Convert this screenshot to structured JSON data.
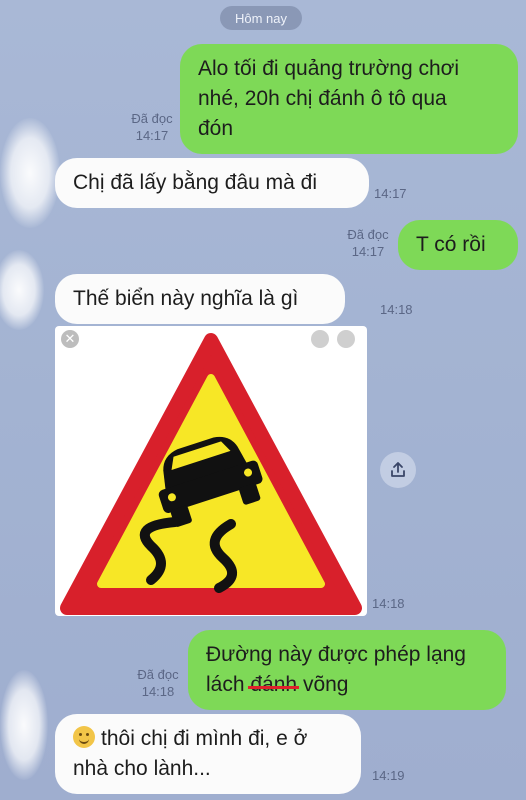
{
  "day_divider": "Hôm nay",
  "messages": [
    {
      "text_line1": "Alo tối đi quảng trường chơi",
      "text_line2": "nhé, 20h chị đánh ô tô qua",
      "text_line3": "đón",
      "status": "Đã đọc",
      "time": "14:17"
    },
    {
      "text": "Chị đã lấy bằng đâu mà đi",
      "time": "14:17"
    },
    {
      "text": "T có rồi",
      "status": "Đã đọc",
      "time": "14:17"
    },
    {
      "text": "Thế biển này nghĩa là gì",
      "time": "14:18"
    },
    {
      "image_alt": "slippery-road-warning-sign",
      "time": "14:18"
    },
    {
      "text_line1": "Đường này được phép lạng",
      "text_line2_a": "lách",
      "text_line2_strike": "đánh",
      "text_line2_b": "võng",
      "status": "Đã đọc",
      "time": "14:18"
    },
    {
      "text_line1": "thôi chị đi mình đi, e ở",
      "text_line2": "nhà cho lành...",
      "time": "14:19"
    }
  ],
  "colors": {
    "background": "#a3b3d2",
    "outgoing_bubble": "#7ed957",
    "incoming_bubble": "#fbfbfb",
    "sign_red": "#d8202b",
    "sign_yellow": "#f7e726"
  }
}
